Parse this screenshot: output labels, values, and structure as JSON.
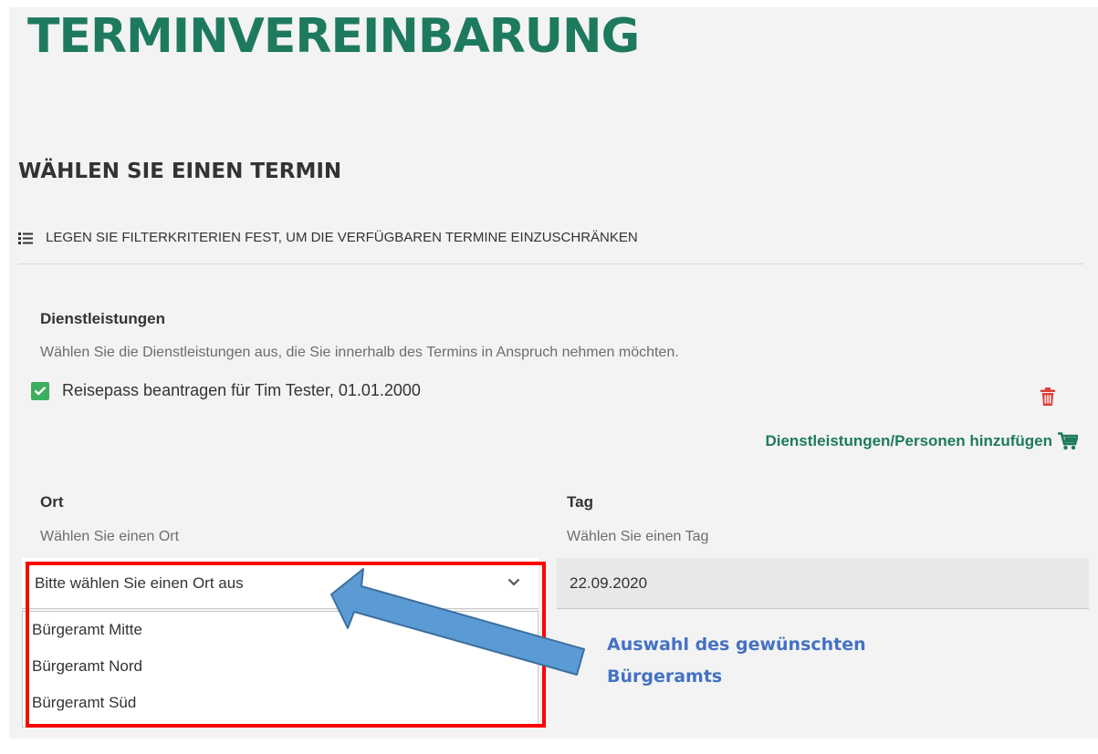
{
  "header": {
    "title": "TERMINVEREINBARUNG"
  },
  "section": {
    "title": "WÄHLEN SIE EINEN TERMIN",
    "filter_hint": "LEGEN SIE FILTERKRITERIEN FEST, UM DIE VERFÜGBAREN TERMINE EINZUSCHRÄNKEN"
  },
  "services": {
    "label": "Dienstleistungen",
    "help": "Wählen Sie die Dienstleistungen aus, die Sie innerhalb des Termins in Anspruch nehmen möchten.",
    "items": [
      {
        "label": "Reisepass beantragen für Tim Tester, 01.01.2000",
        "checked": true
      }
    ],
    "add_link": "Dienstleistungen/Personen hinzufügen"
  },
  "location": {
    "label": "Ort",
    "help": "Wählen Sie einen Ort",
    "placeholder": "Bitte wählen Sie einen Ort aus",
    "options": [
      "Bürgeramt Mitte",
      "Bürgeramt Nord",
      "Bürgeramt Süd"
    ]
  },
  "day": {
    "label": "Tag",
    "help": "Wählen Sie einen Tag",
    "value": "22.09.2020"
  },
  "annotation": {
    "line1": "Auswahl des gewünschten",
    "line2": "Bürgeramts"
  },
  "colors": {
    "brand_green": "#1e7a5e",
    "checkbox_green": "#3dae5f",
    "delete_red": "#e0403a",
    "highlight_red": "#ff0000",
    "annotation_blue": "#4472c4",
    "arrow_blue": "#5b9bd5"
  },
  "icons": {
    "filter": "list-icon",
    "check": "check-icon",
    "delete": "trash-icon",
    "cart": "cart-icon",
    "dropdown": "chevron-down-icon"
  }
}
